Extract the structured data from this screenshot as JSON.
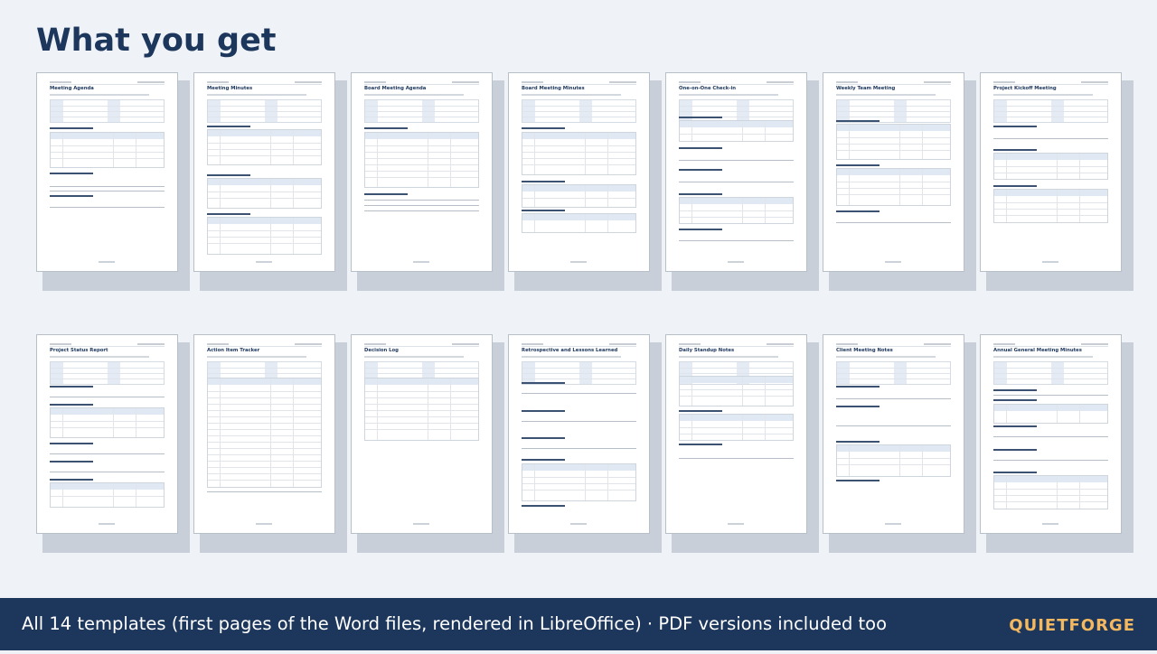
{
  "heading": "What you get",
  "templates": [
    "Meeting Agenda",
    "Meeting Minutes",
    "Board Meeting Agenda",
    "Board Meeting Minutes",
    "One-on-One Check-in",
    "Weekly Team Meeting",
    "Project Kickoff Meeting",
    "Project Status Report",
    "Action Item Tracker",
    "Decision Log",
    "Retrospective and Lessons Learned",
    "Daily Standup Notes",
    "Client Meeting Notes",
    "Annual General Meeting Minutes"
  ],
  "footer": {
    "caption": "All 14 templates (first pages of the Word files, rendered in LibreOffice) · PDF versions included too",
    "brand": "QUIETFORGE"
  },
  "colors": {
    "background": "#eff3f8",
    "navy": "#1c365c",
    "brand_accent": "#f4b860",
    "page_shadow": "#c8cfd8"
  }
}
